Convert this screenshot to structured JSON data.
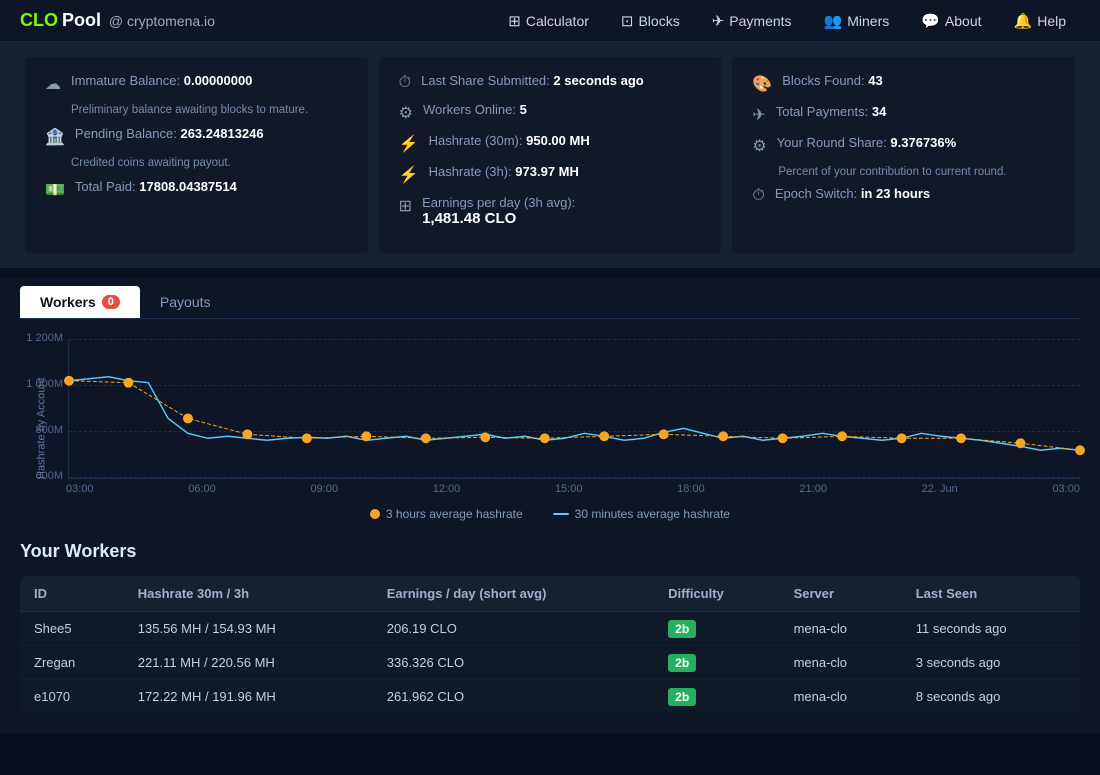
{
  "logo": {
    "clo": "CLO",
    "pool": " Pool",
    "separator": " @ ",
    "domain": "cryptomena.io"
  },
  "nav": {
    "items": [
      {
        "id": "calculator",
        "label": "Calculator",
        "icon": "⊞"
      },
      {
        "id": "blocks",
        "label": "Blocks",
        "icon": "⊡"
      },
      {
        "id": "payments",
        "label": "Payments",
        "icon": "✈"
      },
      {
        "id": "miners",
        "label": "Miners",
        "icon": "👥"
      },
      {
        "id": "about",
        "label": "About",
        "icon": "💬"
      },
      {
        "id": "help",
        "label": "Help",
        "icon": "🔔"
      }
    ]
  },
  "stats": {
    "col1": {
      "immature_label": "Immature Balance:",
      "immature_value": "0.00000000",
      "immature_sub": "Preliminary balance awaiting blocks to mature.",
      "pending_label": "Pending Balance:",
      "pending_value": "263.24813246",
      "pending_sub": "Credited coins awaiting payout.",
      "total_label": "Total Paid:",
      "total_value": "17808.04387514"
    },
    "col2": {
      "last_share_label": "Last Share Submitted:",
      "last_share_value": "2 seconds ago",
      "workers_label": "Workers Online:",
      "workers_value": "5",
      "hashrate30_label": "Hashrate (30m):",
      "hashrate30_value": "950.00 MH",
      "hashrate3h_label": "Hashrate (3h):",
      "hashrate3h_value": "973.97 MH",
      "earnings_label": "Earnings per day (3h avg):",
      "earnings_value": "1,481.48 CLO"
    },
    "col3": {
      "blocks_label": "Blocks Found:",
      "blocks_value": "43",
      "payments_label": "Total Payments:",
      "payments_value": "34",
      "round_label": "Your Round Share:",
      "round_value": "9.376736%",
      "round_sub": "Percent of your contribution to current round.",
      "epoch_label": "Epoch Switch:",
      "epoch_value": "in 23 hours"
    }
  },
  "tabs": {
    "workers_label": "Workers",
    "workers_badge": "0",
    "payouts_label": "Payouts"
  },
  "chart": {
    "y_axis_label": "Hashrate by Account",
    "y_labels": [
      "1 200M",
      "1 000M",
      "800M",
      "600M"
    ],
    "x_labels": [
      "03:00",
      "06:00",
      "09:00",
      "12:00",
      "15:00",
      "18:00",
      "21:00",
      "22. Jun",
      "03:00"
    ],
    "legend": {
      "avg3h_label": "3 hours average hashrate",
      "avg30m_label": "30 minutes average hashrate",
      "avg3h_color": "#f5a623",
      "avg30m_color": "#5bc8f5"
    }
  },
  "workers_section": {
    "title": "Your Workers",
    "columns": [
      "ID",
      "Hashrate 30m / 3h",
      "Earnings / day (short avg)",
      "Difficulty",
      "Server",
      "Last Seen"
    ],
    "rows": [
      {
        "id": "Shee5",
        "hashrate": "135.56 MH / 154.93 MH",
        "earnings": "206.19 CLO",
        "difficulty": "2b",
        "server": "mena-clo",
        "last_seen": "11 seconds ago"
      },
      {
        "id": "Zregan",
        "hashrate": "221.11 MH / 220.56 MH",
        "earnings": "336.326 CLO",
        "difficulty": "2b",
        "server": "mena-clo",
        "last_seen": "3 seconds ago"
      },
      {
        "id": "e1070",
        "hashrate": "172.22 MH / 191.96 MH",
        "earnings": "261.962 CLO",
        "difficulty": "2b",
        "server": "mena-clo",
        "last_seen": "8 seconds ago"
      }
    ]
  }
}
